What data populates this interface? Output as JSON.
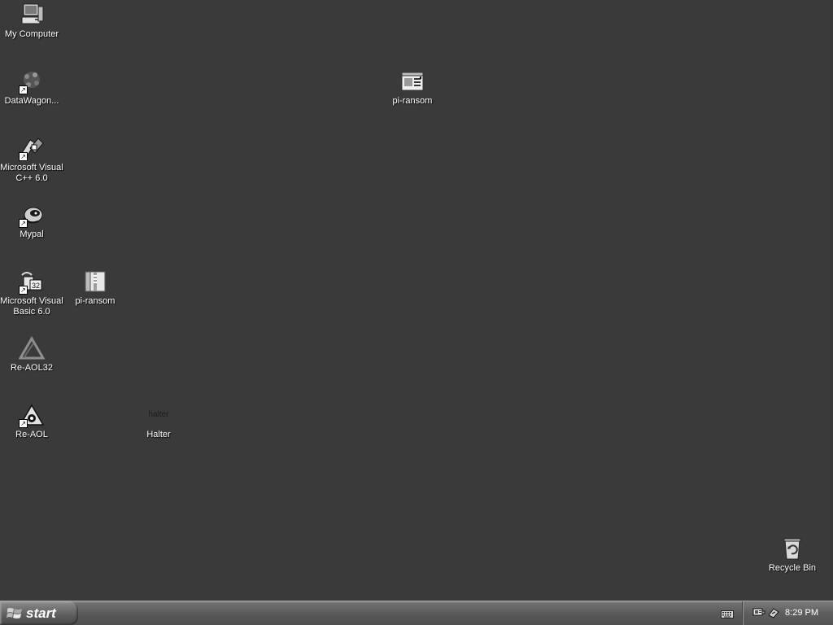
{
  "desktop": {
    "icons": {
      "my_computer": "My Computer",
      "datawagon": "DataWagon...",
      "msvc": "Microsoft Visual C++ 6.0",
      "mypal": "Mypal",
      "msvb": "Microsoft Visual Basic 6.0",
      "pi_ransom_folder": "pi-ransom",
      "pi_ransom_file": "pi-ransom",
      "re_aol32": "Re-AOL32",
      "re_aol": "Re-AOL",
      "halter": "Halter",
      "halter_icon_text": "halter",
      "recycle_bin": "Recycle Bin"
    }
  },
  "taskbar": {
    "start_label": "start",
    "clock": "8:29 PM"
  }
}
